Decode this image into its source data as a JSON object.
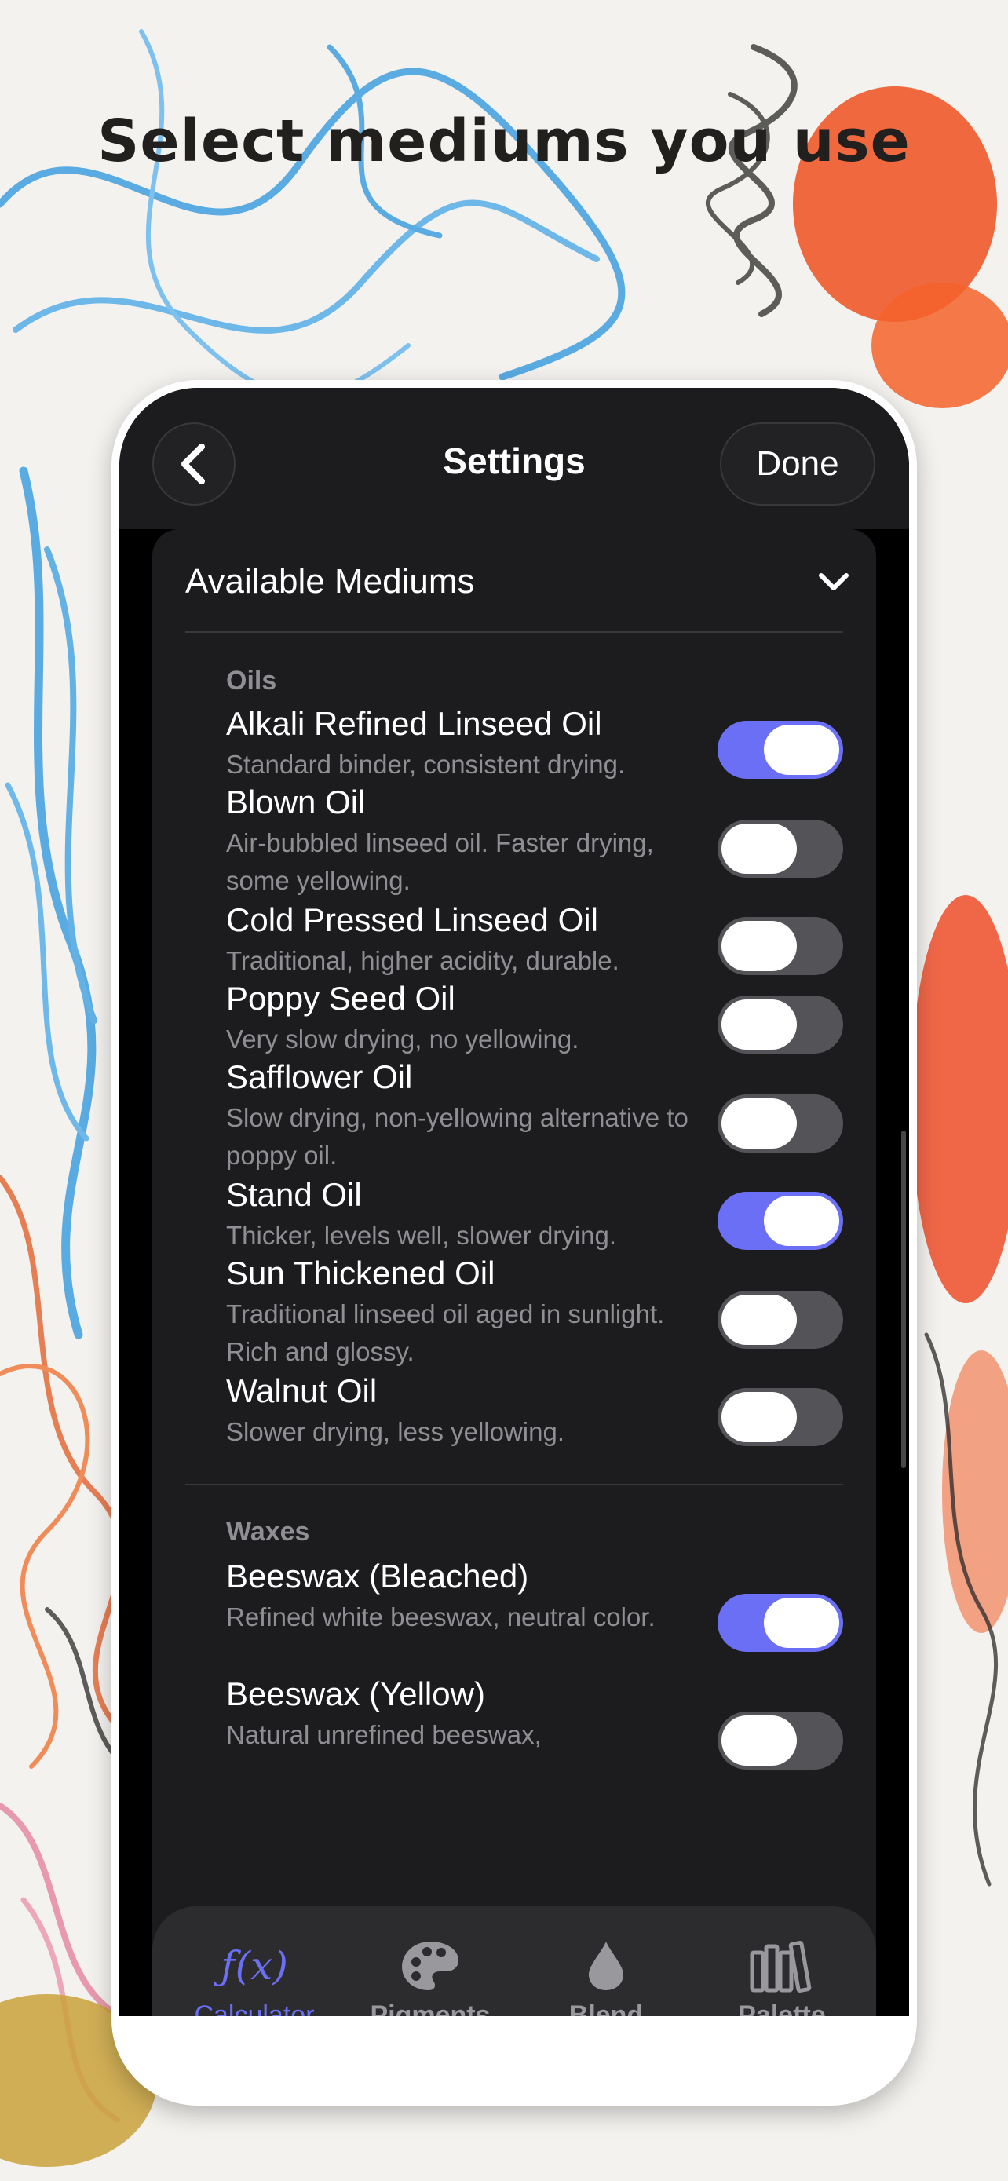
{
  "headline": "Select mediums you use",
  "nav": {
    "title": "Settings",
    "back_icon": "chevron-left-icon",
    "done_label": "Done"
  },
  "section": {
    "title": "Available Mediums",
    "toggle_icon": "chevron-down-icon"
  },
  "groups": [
    {
      "label": "Oils",
      "items": [
        {
          "title": "Alkali Refined Linseed Oil",
          "desc": "Standard binder, consistent drying.",
          "enabled": true
        },
        {
          "title": "Blown Oil",
          "desc": "Air-bubbled linseed oil. Faster drying, some yellowing.",
          "enabled": false
        },
        {
          "title": "Cold Pressed Linseed Oil",
          "desc": "Traditional, higher acidity, durable.",
          "enabled": false
        },
        {
          "title": "Poppy Seed Oil",
          "desc": "Very slow drying, no yellowing.",
          "enabled": false
        },
        {
          "title": "Safflower Oil",
          "desc": "Slow drying, non-yellowing alternative to poppy oil.",
          "enabled": false
        },
        {
          "title": "Stand Oil",
          "desc": "Thicker, levels well, slower drying.",
          "enabled": true
        },
        {
          "title": "Sun Thickened Oil",
          "desc": "Traditional linseed oil aged in sunlight. Rich and glossy.",
          "enabled": false
        },
        {
          "title": "Walnut Oil",
          "desc": "Slower drying, less yellowing.",
          "enabled": false
        }
      ]
    },
    {
      "label": "Waxes",
      "items": [
        {
          "title": "Beeswax (Bleached)",
          "desc": "Refined white beeswax, neutral color.",
          "enabled": true
        },
        {
          "title": "Beeswax (Yellow)",
          "desc": "Natural unrefined beeswax,",
          "enabled": false
        }
      ]
    }
  ],
  "tabs": [
    {
      "label": "Calculator",
      "icon": "function-icon",
      "active": true
    },
    {
      "label": "Pigments",
      "icon": "palette-icon",
      "active": false
    },
    {
      "label": "Blend",
      "icon": "drop-icon",
      "active": false
    },
    {
      "label": "Palette",
      "icon": "books-icon",
      "active": false
    }
  ],
  "colors": {
    "accent": "#6b6ff5",
    "screen_bg": "#1c1c1e",
    "toggle_off": "#545458"
  }
}
